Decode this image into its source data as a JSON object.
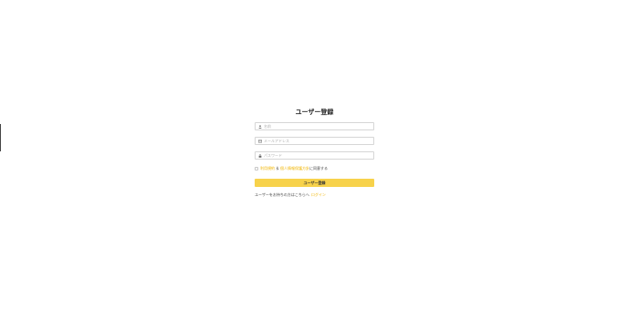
{
  "form": {
    "title": "ユーザー登録",
    "name_placeholder": "名前",
    "email_placeholder": "メールアドレス",
    "password_placeholder": "パスワード",
    "terms_link": "利用規約",
    "and_text": "＆",
    "privacy_link": "個人情報保護方針",
    "agree_suffix": "に同意する",
    "submit_label": "ユーザー登録",
    "login_prompt": "ユーザーをお持ちの方はこちらへ",
    "login_link": "ログイン"
  },
  "colors": {
    "accent": "#f7d24b",
    "link": "#f0b400"
  }
}
